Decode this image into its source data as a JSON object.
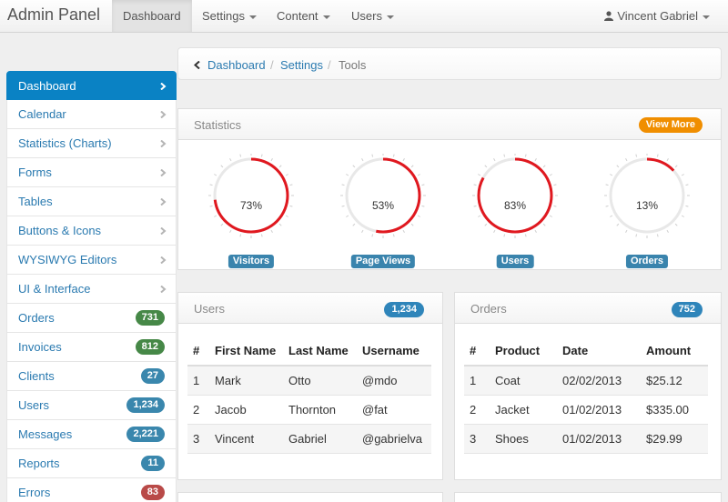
{
  "navbar": {
    "brand": "Admin Panel",
    "items": [
      {
        "label": "Dashboard"
      },
      {
        "label": "Settings"
      },
      {
        "label": "Content"
      },
      {
        "label": "Users"
      }
    ],
    "user": "Vincent Gabriel",
    "icons": [
      "user-icon",
      "caret-down-icon"
    ]
  },
  "sidebar": {
    "items": [
      {
        "label": "Dashboard"
      },
      {
        "label": "Calendar"
      },
      {
        "label": "Statistics (Charts)"
      },
      {
        "label": "Forms"
      },
      {
        "label": "Tables"
      },
      {
        "label": "Buttons & Icons"
      },
      {
        "label": "WYSIWYG Editors"
      },
      {
        "label": "UI & Interface"
      },
      {
        "label": "Orders",
        "badge": "731",
        "color": "#468847"
      },
      {
        "label": "Invoices",
        "badge": "812",
        "color": "#468847"
      },
      {
        "label": "Clients",
        "badge": "27",
        "color": "#3a87ad"
      },
      {
        "label": "Users",
        "badge": "1,234",
        "color": "#3a87ad"
      },
      {
        "label": "Messages",
        "badge": "2,221",
        "color": "#3a87ad"
      },
      {
        "label": "Reports",
        "badge": "11",
        "color": "#3a87ad"
      },
      {
        "label": "Errors",
        "badge": "83",
        "color": "#b94a48"
      }
    ]
  },
  "breadcrumb": {
    "items": [
      "Dashboard",
      "Settings"
    ],
    "current": "Tools"
  },
  "statistics": {
    "title": "Statistics",
    "more_label": "View More",
    "gauges": [
      {
        "value": 73,
        "display": "73%",
        "label": "Visitors"
      },
      {
        "value": 53,
        "display": "53%",
        "label": "Page Views"
      },
      {
        "value": 83,
        "display": "83%",
        "label": "Users"
      },
      {
        "value": 13,
        "display": "13%",
        "label": "Orders"
      }
    ],
    "accent": "#e0181f"
  },
  "users_panel": {
    "title": "Users",
    "badge": "1,234",
    "columns": [
      "#",
      "First Name",
      "Last Name",
      "Username"
    ],
    "rows": [
      [
        "1",
        "Mark",
        "Otto",
        "@mdo"
      ],
      [
        "2",
        "Jacob",
        "Thornton",
        "@fat"
      ],
      [
        "3",
        "Vincent",
        "Gabriel",
        "@gabrielva"
      ]
    ]
  },
  "orders_panel": {
    "title": "Orders",
    "badge": "752",
    "columns": [
      "#",
      "Product",
      "Date",
      "Amount"
    ],
    "rows": [
      [
        "1",
        "Coat",
        "02/02/2013",
        "$25.12"
      ],
      [
        "2",
        "Jacket",
        "01/02/2013",
        "$335.00"
      ],
      [
        "3",
        "Shoes",
        "01/02/2013",
        "$29.99"
      ]
    ]
  }
}
